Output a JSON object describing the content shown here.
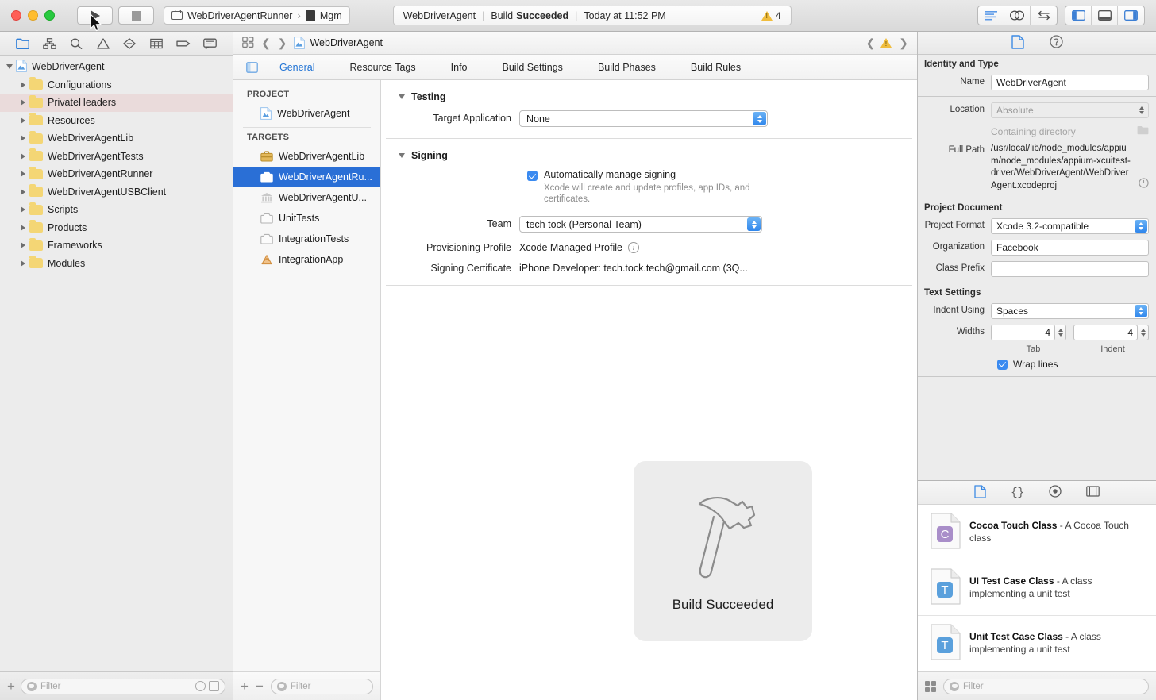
{
  "toolbar": {
    "run_label": "Run",
    "stop_label": "Stop",
    "scheme": "WebDriverAgentRunner",
    "destination": "Mgm",
    "status": {
      "project": "WebDriverAgent",
      "action": "Build",
      "result": "Succeeded",
      "time": "Today at 11:52 PM",
      "warning_count": "4"
    },
    "right_buttons": [
      {
        "name": "standard-editor-button",
        "icon": "list-lines-icon"
      },
      {
        "name": "assistant-editor-button",
        "icon": "venn-circles-icon"
      },
      {
        "name": "version-editor-button",
        "icon": "arrows-swap-icon"
      },
      {
        "name": "toggle-navigator-button",
        "icon": "left-panel-icon"
      },
      {
        "name": "toggle-debug-area-button",
        "icon": "bottom-panel-icon"
      },
      {
        "name": "toggle-inspector-button",
        "icon": "right-panel-icon"
      }
    ]
  },
  "navigator": {
    "tabs": [
      {
        "name": "project-navigator-tab",
        "icon": "folder-icon",
        "active": true
      },
      {
        "name": "source-control-navigator-tab",
        "icon": "source-control-icon"
      },
      {
        "name": "symbol-navigator-tab",
        "icon": "search-icon"
      },
      {
        "name": "issue-navigator-tab",
        "icon": "warning-triangle-icon"
      },
      {
        "name": "test-navigator-tab",
        "icon": "diamond-minus-icon"
      },
      {
        "name": "debug-navigator-tab",
        "icon": "table-icon"
      },
      {
        "name": "breakpoint-navigator-tab",
        "icon": "tag-icon"
      },
      {
        "name": "report-navigator-tab",
        "icon": "speech-bubble-icon"
      }
    ],
    "tree": [
      {
        "label": "WebDriverAgent",
        "type": "project",
        "depth": 0,
        "expanded": true,
        "warn": false
      },
      {
        "label": "Configurations",
        "type": "folder",
        "depth": 1,
        "expanded": false,
        "warn": false
      },
      {
        "label": "PrivateHeaders",
        "type": "folder",
        "depth": 1,
        "expanded": false,
        "warn": true
      },
      {
        "label": "Resources",
        "type": "folder",
        "depth": 1,
        "expanded": false,
        "warn": false
      },
      {
        "label": "WebDriverAgentLib",
        "type": "folder",
        "depth": 1,
        "expanded": false,
        "warn": false
      },
      {
        "label": "WebDriverAgentTests",
        "type": "folder",
        "depth": 1,
        "expanded": false,
        "warn": false
      },
      {
        "label": "WebDriverAgentRunner",
        "type": "folder",
        "depth": 1,
        "expanded": false,
        "warn": false
      },
      {
        "label": "WebDriverAgentUSBClient",
        "type": "folder",
        "depth": 1,
        "expanded": false,
        "warn": false
      },
      {
        "label": "Scripts",
        "type": "folder",
        "depth": 1,
        "expanded": false,
        "warn": false
      },
      {
        "label": "Products",
        "type": "folder",
        "depth": 1,
        "expanded": false,
        "warn": false
      },
      {
        "label": "Frameworks",
        "type": "folder",
        "depth": 1,
        "expanded": false,
        "warn": false
      },
      {
        "label": "Modules",
        "type": "folder",
        "depth": 1,
        "expanded": false,
        "warn": false
      }
    ],
    "bottom": {
      "add_label": "+",
      "filter_placeholder": "Filter"
    }
  },
  "editor": {
    "jumpbar": {
      "title": "WebDriverAgent",
      "warning_icon": "warning-triangle-icon"
    },
    "tabs": [
      {
        "label": "General",
        "active": true
      },
      {
        "label": "Resource Tags",
        "active": false
      },
      {
        "label": "Info",
        "active": false
      },
      {
        "label": "Build Settings",
        "active": false
      },
      {
        "label": "Build Phases",
        "active": false
      },
      {
        "label": "Build Rules",
        "active": false
      }
    ],
    "targets_panel": {
      "project_header": "PROJECT",
      "project_items": [
        {
          "label": "WebDriverAgent",
          "icon": "xcode-project-icon"
        }
      ],
      "targets_header": "TARGETS",
      "target_items": [
        {
          "label": "WebDriverAgentLib",
          "icon": "framework-target-icon",
          "selected": false
        },
        {
          "label": "WebDriverAgentRu...",
          "icon": "test-target-icon",
          "selected": true
        },
        {
          "label": "WebDriverAgentU...",
          "icon": "bank-target-icon",
          "selected": false
        },
        {
          "label": "UnitTests",
          "icon": "test-target-icon",
          "selected": false
        },
        {
          "label": "IntegrationTests",
          "icon": "test-target-icon",
          "selected": false
        },
        {
          "label": "IntegrationApp",
          "icon": "app-target-icon",
          "selected": false
        }
      ],
      "bottom": {
        "add_label": "+",
        "remove_label": "−",
        "filter_placeholder": "Filter"
      }
    },
    "general": {
      "testing": {
        "title": "Testing",
        "target_application_label": "Target Application",
        "target_application_value": "None"
      },
      "signing": {
        "title": "Signing",
        "auto_manage_label": "Automatically manage signing",
        "auto_manage_checked": true,
        "auto_manage_hint": "Xcode will create and update profiles, app IDs, and certificates.",
        "team_label": "Team",
        "team_value": "tech tock (Personal Team)",
        "provisioning_profile_label": "Provisioning Profile",
        "provisioning_profile_value": "Xcode Managed Profile",
        "signing_certificate_label": "Signing Certificate",
        "signing_certificate_value": "iPhone Developer: tech.tock.tech@gmail.com (3Q..."
      }
    },
    "hud": {
      "label": "Build Succeeded",
      "icon": "hammer-icon"
    }
  },
  "inspector": {
    "tabs": [
      {
        "name": "file-inspector-tab",
        "icon": "document-icon",
        "active": true
      },
      {
        "name": "quick-help-inspector-tab",
        "icon": "question-circle-icon",
        "active": false
      }
    ],
    "identity": {
      "title": "Identity and Type",
      "name_label": "Name",
      "name_value": "WebDriverAgent",
      "location_label": "Location",
      "location_value": "Absolute",
      "containing_directory_label": "Containing directory",
      "full_path_label": "Full Path",
      "full_path_value": "/usr/local/lib/node_modules/appium/node_modules/appium-xcuitest-driver/WebDriverAgent/WebDriverAgent.xcodeproj"
    },
    "project_document": {
      "title": "Project Document",
      "project_format_label": "Project Format",
      "project_format_value": "Xcode 3.2-compatible",
      "organization_label": "Organization",
      "organization_value": "Facebook",
      "class_prefix_label": "Class Prefix",
      "class_prefix_value": ""
    },
    "text_settings": {
      "title": "Text Settings",
      "indent_using_label": "Indent Using",
      "indent_using_value": "Spaces",
      "widths_label": "Widths",
      "tab_value": "4",
      "indent_value": "4",
      "tab_sublabel": "Tab",
      "indent_sublabel": "Indent",
      "wrap_lines_label": "Wrap lines",
      "wrap_lines_checked": true
    },
    "library": {
      "tabs": [
        {
          "name": "file-template-library-tab",
          "icon": "document-icon",
          "active": true
        },
        {
          "name": "code-snippet-library-tab",
          "icon": "braces-icon",
          "active": false
        },
        {
          "name": "object-library-tab",
          "icon": "circle-dot-icon",
          "active": false
        },
        {
          "name": "media-library-tab",
          "icon": "film-icon",
          "active": false
        }
      ],
      "items": [
        {
          "title": "Cocoa Touch Class",
          "desc": "- A Cocoa Touch class",
          "badge": "C",
          "badge_color": "#a98ec9"
        },
        {
          "title": "UI Test Case Class",
          "desc": "- A class implementing a unit test",
          "badge": "T",
          "badge_color": "#5aa0dc"
        },
        {
          "title": "Unit Test Case Class",
          "desc": "- A class implementing a unit test",
          "badge": "T",
          "badge_color": "#5aa0dc"
        }
      ],
      "bottom": {
        "filter_placeholder": "Filter"
      }
    }
  }
}
